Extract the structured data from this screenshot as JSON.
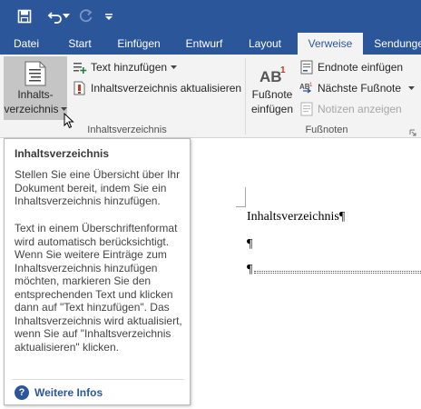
{
  "qat": {
    "save": "save-icon",
    "undo": "undo-icon",
    "redo": "redo-icon",
    "customize": "customize-qat-icon"
  },
  "tabs": [
    {
      "label": "Datei"
    },
    {
      "label": "Start"
    },
    {
      "label": "Einfügen"
    },
    {
      "label": "Entwurf"
    },
    {
      "label": "Layout"
    },
    {
      "label": "Verweise",
      "active": true
    },
    {
      "label": "Sendungen"
    }
  ],
  "ribbon": {
    "toc_group": {
      "toc_button_line1": "Inhalts-",
      "toc_button_line2": "verzeichnis",
      "add_text": "Text hinzufügen",
      "update_toc": "Inhaltsverzeichnis aktualisieren",
      "label": "Inhaltsverzeichnis"
    },
    "footnotes_group": {
      "insert_footnote_line1": "Fußnote",
      "insert_footnote_line2": "einfügen",
      "insert_endnote": "Endnote einfügen",
      "next_footnote": "Nächste Fußnote",
      "show_notes": "Notizen anzeigen",
      "label": "Fußnoten"
    }
  },
  "document": {
    "heading": "Inhaltsverzeichnis¶",
    "para1": "¶",
    "para2": "¶"
  },
  "tooltip": {
    "title": "Inhaltsverzeichnis",
    "para1": "Stellen Sie eine Übersicht über Ihr Dokument bereit, indem Sie ein Inhaltsverzeichnis hinzufügen.",
    "para2": "Text in einem Überschriftenformat wird automatisch berücksichtigt. Wenn Sie weitere Einträge zum Inhaltsverzeichnis hinzufügen möchten, markieren Sie den entsprechenden Text und klicken dann auf \"Text hinzufügen\". Das Inhaltsverzeichnis wird aktualisiert, wenn Sie auf \"Inhaltsverzeichnis aktualisieren\" klicken.",
    "more_info": "Weitere Infos"
  },
  "colors": {
    "brand": "#2b579a",
    "ribbon_bg": "#f3f3f3",
    "update_icon": "#c0392b"
  }
}
